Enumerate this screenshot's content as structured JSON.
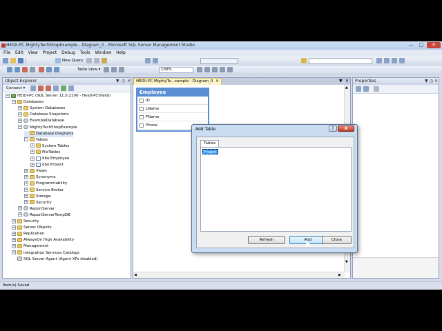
{
  "window": {
    "title": "HEIDI-PC.MightyTechShopExample - Diagram_0 - Microsoft SQL Server Management Studio"
  },
  "menu": [
    "File",
    "Edit",
    "View",
    "Project",
    "Debug",
    "Tools",
    "Window",
    "Help"
  ],
  "toolbar": {
    "new_query_label": "New Query",
    "table_view_label": "Table View ▾",
    "zoom_value": "100%"
  },
  "object_explorer": {
    "title": "Object Explorer",
    "connect_label": "Connect ▾",
    "tree": [
      {
        "label": "HEIDI-PC (SQL Server 11.0.2100 - Heidi-PC\\Heidi)",
        "icon": "server",
        "level": 0,
        "exp": "-"
      },
      {
        "label": "Databases",
        "icon": "folder",
        "level": 1,
        "exp": "-"
      },
      {
        "label": "System Databases",
        "icon": "folder",
        "level": 2,
        "exp": "+"
      },
      {
        "label": "Database Snapshots",
        "icon": "folder",
        "level": 2,
        "exp": "+"
      },
      {
        "label": "ExampleDatabase",
        "icon": "db",
        "level": 2,
        "exp": "+"
      },
      {
        "label": "MightyTechShopExample",
        "icon": "db",
        "level": 2,
        "exp": "-"
      },
      {
        "label": "Database Diagrams",
        "icon": "diag",
        "level": 3,
        "exp": "",
        "selected": true
      },
      {
        "label": "Tables",
        "icon": "folder",
        "level": 3,
        "exp": "-"
      },
      {
        "label": "System Tables",
        "icon": "folder",
        "level": 4,
        "exp": "+"
      },
      {
        "label": "FileTables",
        "icon": "folder",
        "level": 4,
        "exp": "+"
      },
      {
        "label": "dbo.Employee",
        "icon": "table",
        "level": 4,
        "exp": "+"
      },
      {
        "label": "dbo.Project",
        "icon": "table",
        "level": 4,
        "exp": "+"
      },
      {
        "label": "Views",
        "icon": "folder",
        "level": 3,
        "exp": "+"
      },
      {
        "label": "Synonyms",
        "icon": "folder",
        "level": 3,
        "exp": "+"
      },
      {
        "label": "Programmability",
        "icon": "folder",
        "level": 3,
        "exp": "+"
      },
      {
        "label": "Service Broker",
        "icon": "folder",
        "level": 3,
        "exp": "+"
      },
      {
        "label": "Storage",
        "icon": "folder",
        "level": 3,
        "exp": "+"
      },
      {
        "label": "Security",
        "icon": "folder",
        "level": 3,
        "exp": "+"
      },
      {
        "label": "ReportServer",
        "icon": "db",
        "level": 2,
        "exp": "+"
      },
      {
        "label": "ReportServerTempDB",
        "icon": "db",
        "level": 2,
        "exp": "+"
      },
      {
        "label": "Security",
        "icon": "folder",
        "level": 1,
        "exp": "+"
      },
      {
        "label": "Server Objects",
        "icon": "folder",
        "level": 1,
        "exp": "+"
      },
      {
        "label": "Replication",
        "icon": "folder",
        "level": 1,
        "exp": "+"
      },
      {
        "label": "AlwaysOn High Availability",
        "icon": "folder",
        "level": 1,
        "exp": "+"
      },
      {
        "label": "Management",
        "icon": "folder",
        "level": 1,
        "exp": "+"
      },
      {
        "label": "Integration Services Catalogs",
        "icon": "folder",
        "level": 1,
        "exp": "+"
      },
      {
        "label": "SQL Server Agent (Agent XPs disabled)",
        "icon": "agent",
        "level": 1,
        "exp": ""
      }
    ]
  },
  "document": {
    "tab_label": "HEIDI-PC.MightyTe...xample - Diagram_0",
    "table_title": "Employee",
    "columns": [
      "ID",
      "LName",
      "FName",
      "Phone"
    ]
  },
  "properties": {
    "title": "Properties"
  },
  "status": {
    "text": "Item(s) Saved"
  },
  "dialog": {
    "title": "Add Table",
    "tab_label": "Tables",
    "items": [
      "Project"
    ],
    "refresh_label": "Refresh",
    "add_label": "Add",
    "close_label": "Close",
    "help_label": "?",
    "close_x": "X"
  },
  "colors": {
    "accent": "#5b8fd3",
    "selection": "#3399ff"
  }
}
